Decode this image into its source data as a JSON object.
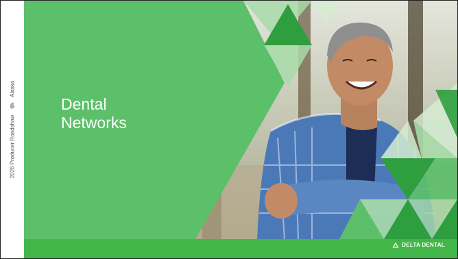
{
  "slide": {
    "side_label_event": "2026 Producer Roadshow",
    "side_label_region": "Alaska",
    "title_line1": "Dental",
    "title_line2": "Networks",
    "logo_text": "DELTA DENTAL"
  },
  "icons": {
    "region_icon": "alaska-map-icon",
    "logo_icon": "delta-triangle-icon"
  },
  "colors": {
    "primary_green": "#5cc06a",
    "footer_green": "#43b649",
    "dark_green": "#2e9e3e",
    "light_green": "#a8dba8",
    "pale_green": "#d3ecd1"
  }
}
